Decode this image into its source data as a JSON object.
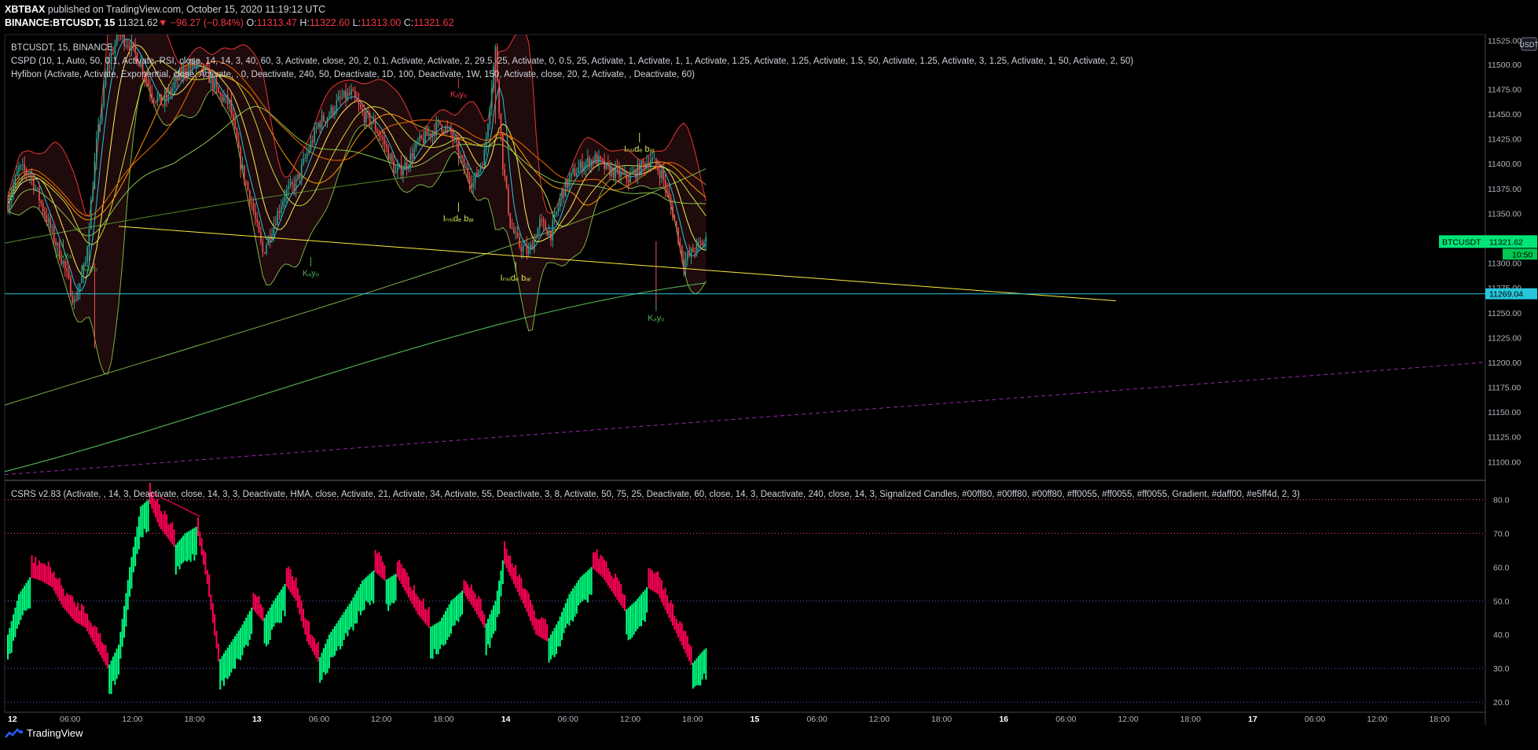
{
  "header": {
    "author": "XBTBAX",
    "published": "published on TradingView.com, October 15, 2020 11:19:12 UTC",
    "symbol_line": "BINANCE:BTCUSDT, 15",
    "price": "11321.62",
    "change": "−96.27 (−0.84%)",
    "o_label": "O:",
    "o_val": "11313.47",
    "h_label": "H:",
    "h_val": "11322.60",
    "l_label": "L:",
    "l_val": "11313.00",
    "c_label": "C:",
    "c_val": "11321.62"
  },
  "legend": {
    "line1": "BTCUSDT, 15, BINANCE",
    "line2": "CSPD (10, 1, Auto, 50, 0.1, Activate, RSI, close, 14, 14, 3, 40, 60, 3, Activate, close, 20, 2, 0.1, Activate, Activate, 2, 29.5, 25, Activate, 0, 0.5, 25, Activate, 1, Activate, 1, 1, Activate, 1.25, Activate, 1.25, Activate, 1.5, 50, Activate, 1.25, Activate, 3, 1.25, Activate, 1, 50, Activate, 2, 50)",
    "line3": "Hyfibon (Activate, Activate, Exponential, close, Activate, , 0, Deactivate, 240, 50, Deactivate, 1D, 100, Deactivate, 1W, 150, Activate, close, 20, 2, Activate, , Deactivate, 60)",
    "osc": "CSRS v2.83 (Activate, , 14, 3, Deactivate, close, 14, 3, 3, Deactivate, HMA, close, Activate, 21, Activate, 34, Activate, 55, Deactivate, 3, 8, Activate, 50, 75, 25, Deactivate, 60, close, 14, 3, Deactivate, 240, close, 14, 3, Signalized Candles, #00ff80, #00ff80, #00ff80, #ff0055, #ff0055, #ff0055, Gradient, #daff00, #e5ff4d, 2, 3)"
  },
  "footer": {
    "brand": "TradingView"
  },
  "chart_data": {
    "type": "candlestick",
    "currency": "USDT",
    "price_axis": {
      "ticks": [
        "11500.00",
        "11475.00",
        "11450.00",
        "11425.00",
        "11400.00",
        "11375.00",
        "11350.00",
        "11325.00",
        "11300.00",
        "11275.00",
        "11250.00",
        "11225.00",
        "11200.00",
        "11175.00",
        "11150.00",
        "11125.00",
        "11100.00"
      ],
      "top_label": "11525.00",
      "ylim": [
        11082,
        11530
      ]
    },
    "last_price": {
      "label": "BTCUSDT",
      "value": "11321.62",
      "countdown": "10:50",
      "y": 11321.62
    },
    "hline": {
      "value": "11269.04",
      "y": 11269.04
    },
    "time_axis": [
      "12",
      "06:00",
      "12:00",
      "18:00",
      "13",
      "06:00",
      "12:00",
      "18:00",
      "14",
      "06:00",
      "12:00",
      "18:00",
      "15",
      "06:00",
      "12:00",
      "18:00",
      "16",
      "06:00",
      "12:00",
      "18:00",
      "17",
      "06:00",
      "12:00",
      "18:00"
    ],
    "time_axis_bold": [
      "12",
      "13",
      "14",
      "15",
      "16",
      "17"
    ],
    "price_series": [
      {
        "t": 0,
        "p": 11360
      },
      {
        "t": 6,
        "p": 11395
      },
      {
        "t": 12,
        "p": 11390
      },
      {
        "t": 18,
        "p": 11360
      },
      {
        "t": 24,
        "p": 11330
      },
      {
        "t": 30,
        "p": 11300
      },
      {
        "t": 36,
        "p": 11260
      },
      {
        "t": 42,
        "p": 11300
      },
      {
        "t": 48,
        "p": 11420
      },
      {
        "t": 54,
        "p": 11500
      },
      {
        "t": 60,
        "p": 11530
      },
      {
        "t": 66,
        "p": 11520
      },
      {
        "t": 72,
        "p": 11500
      },
      {
        "t": 78,
        "p": 11470
      },
      {
        "t": 84,
        "p": 11460
      },
      {
        "t": 90,
        "p": 11480
      },
      {
        "t": 96,
        "p": 11495
      },
      {
        "t": 102,
        "p": 11500
      },
      {
        "t": 108,
        "p": 11490
      },
      {
        "t": 114,
        "p": 11470
      },
      {
        "t": 120,
        "p": 11460
      },
      {
        "t": 126,
        "p": 11400
      },
      {
        "t": 132,
        "p": 11360
      },
      {
        "t": 138,
        "p": 11310
      },
      {
        "t": 144,
        "p": 11340
      },
      {
        "t": 150,
        "p": 11370
      },
      {
        "t": 156,
        "p": 11380
      },
      {
        "t": 162,
        "p": 11410
      },
      {
        "t": 168,
        "p": 11440
      },
      {
        "t": 174,
        "p": 11450
      },
      {
        "t": 180,
        "p": 11465
      },
      {
        "t": 186,
        "p": 11470
      },
      {
        "t": 192,
        "p": 11450
      },
      {
        "t": 198,
        "p": 11440
      },
      {
        "t": 204,
        "p": 11420
      },
      {
        "t": 210,
        "p": 11390
      },
      {
        "t": 216,
        "p": 11400
      },
      {
        "t": 222,
        "p": 11420
      },
      {
        "t": 228,
        "p": 11430
      },
      {
        "t": 234,
        "p": 11440
      },
      {
        "t": 240,
        "p": 11430
      },
      {
        "t": 246,
        "p": 11400
      },
      {
        "t": 252,
        "p": 11380
      },
      {
        "t": 258,
        "p": 11410
      },
      {
        "t": 264,
        "p": 11515
      },
      {
        "t": 268,
        "p": 11400
      },
      {
        "t": 272,
        "p": 11340
      },
      {
        "t": 276,
        "p": 11320
      },
      {
        "t": 282,
        "p": 11310
      },
      {
        "t": 288,
        "p": 11340
      },
      {
        "t": 294,
        "p": 11330
      },
      {
        "t": 300,
        "p": 11370
      },
      {
        "t": 306,
        "p": 11390
      },
      {
        "t": 312,
        "p": 11400
      },
      {
        "t": 318,
        "p": 11405
      },
      {
        "t": 324,
        "p": 11395
      },
      {
        "t": 330,
        "p": 11390
      },
      {
        "t": 336,
        "p": 11385
      },
      {
        "t": 342,
        "p": 11395
      },
      {
        "t": 348,
        "p": 11405
      },
      {
        "t": 354,
        "p": 11390
      },
      {
        "t": 360,
        "p": 11350
      },
      {
        "t": 366,
        "p": 11300
      },
      {
        "t": 372,
        "p": 11315
      },
      {
        "t": 378,
        "p": 11322
      }
    ],
    "markers": [
      {
        "label": "Kₐyₒ",
        "t": 30,
        "p": 11313,
        "color": "#4caf50"
      },
      {
        "label": "Kₐyₒ",
        "t": 44,
        "p": 11300,
        "color": "#4caf50"
      },
      {
        "label": "Kₐyₒ",
        "t": 164,
        "p": 11295,
        "color": "#4caf50"
      },
      {
        "label": "Kₐyₒ",
        "t": 244,
        "p": 11475,
        "color": "#f23645"
      },
      {
        "label": "Iₙₛᵢdₑ bₐᵣ",
        "t": 244,
        "p": 11350,
        "color": "#d4e157"
      },
      {
        "label": "Iₙₛᵢdₑ bₐᵣ",
        "t": 275,
        "p": 11290,
        "color": "#d4e157"
      },
      {
        "label": "Iₙₛᵢdₑ bₐᵣ",
        "t": 342,
        "p": 11420,
        "color": "#d4e157"
      },
      {
        "label": "Kₐyₒ",
        "t": 351,
        "p": 11250,
        "color": "#4caf50"
      }
    ],
    "oscillator": {
      "name": "CSRS v2.83",
      "ticks": [
        "80.0",
        "70.0",
        "60.0",
        "50.0",
        "40.0",
        "30.0",
        "20.0"
      ],
      "ylim": [
        17,
        85
      ],
      "levels": [
        80,
        70,
        50,
        30,
        20
      ],
      "colors": {
        "up": "#00ff80",
        "down": "#ff0055"
      },
      "values": [
        {
          "t": 0,
          "v": 40
        },
        {
          "t": 6,
          "v": 52
        },
        {
          "t": 12,
          "v": 57
        },
        {
          "t": 18,
          "v": 56
        },
        {
          "t": 24,
          "v": 54
        },
        {
          "t": 30,
          "v": 48
        },
        {
          "t": 36,
          "v": 44
        },
        {
          "t": 42,
          "v": 42
        },
        {
          "t": 48,
          "v": 36
        },
        {
          "t": 54,
          "v": 30
        },
        {
          "t": 60,
          "v": 37
        },
        {
          "t": 66,
          "v": 60
        },
        {
          "t": 72,
          "v": 78
        },
        {
          "t": 76,
          "v": 80
        },
        {
          "t": 82,
          "v": 72
        },
        {
          "t": 90,
          "v": 66
        },
        {
          "t": 96,
          "v": 70
        },
        {
          "t": 102,
          "v": 72
        },
        {
          "t": 108,
          "v": 55
        },
        {
          "t": 114,
          "v": 32
        },
        {
          "t": 120,
          "v": 37
        },
        {
          "t": 126,
          "v": 42
        },
        {
          "t": 132,
          "v": 48
        },
        {
          "t": 138,
          "v": 44
        },
        {
          "t": 144,
          "v": 50
        },
        {
          "t": 150,
          "v": 55
        },
        {
          "t": 156,
          "v": 50
        },
        {
          "t": 162,
          "v": 38
        },
        {
          "t": 168,
          "v": 32
        },
        {
          "t": 174,
          "v": 40
        },
        {
          "t": 180,
          "v": 45
        },
        {
          "t": 186,
          "v": 50
        },
        {
          "t": 192,
          "v": 56
        },
        {
          "t": 198,
          "v": 59
        },
        {
          "t": 204,
          "v": 56
        },
        {
          "t": 210,
          "v": 58
        },
        {
          "t": 216,
          "v": 52
        },
        {
          "t": 222,
          "v": 46
        },
        {
          "t": 228,
          "v": 42
        },
        {
          "t": 234,
          "v": 44
        },
        {
          "t": 240,
          "v": 50
        },
        {
          "t": 246,
          "v": 53
        },
        {
          "t": 252,
          "v": 48
        },
        {
          "t": 258,
          "v": 42
        },
        {
          "t": 264,
          "v": 50
        },
        {
          "t": 268,
          "v": 62
        },
        {
          "t": 274,
          "v": 55
        },
        {
          "t": 280,
          "v": 48
        },
        {
          "t": 286,
          "v": 40
        },
        {
          "t": 292,
          "v": 38
        },
        {
          "t": 298,
          "v": 44
        },
        {
          "t": 304,
          "v": 52
        },
        {
          "t": 310,
          "v": 57
        },
        {
          "t": 316,
          "v": 60
        },
        {
          "t": 322,
          "v": 57
        },
        {
          "t": 328,
          "v": 52
        },
        {
          "t": 334,
          "v": 47
        },
        {
          "t": 340,
          "v": 50
        },
        {
          "t": 346,
          "v": 54
        },
        {
          "t": 352,
          "v": 52
        },
        {
          "t": 358,
          "v": 45
        },
        {
          "t": 364,
          "v": 38
        },
        {
          "t": 370,
          "v": 31
        },
        {
          "t": 376,
          "v": 35
        },
        {
          "t": 378,
          "v": 36
        }
      ]
    }
  }
}
